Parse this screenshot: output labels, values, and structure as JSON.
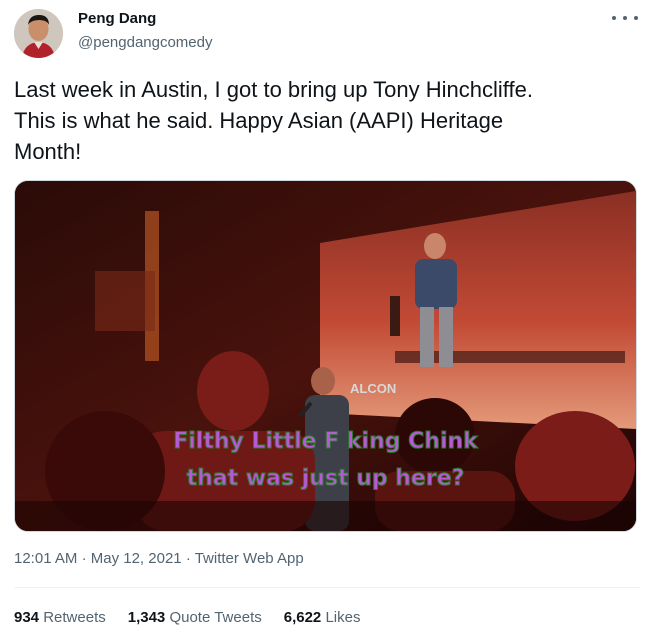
{
  "author": {
    "name": "Peng Dang",
    "handle": "@pengdangcomedy"
  },
  "tweet": {
    "text": "Last week in Austin, I got to bring up Tony Hinchcliffe.\nThis is what he said. Happy Asian (AAPI) Heritage\nMonth!"
  },
  "media": {
    "caption_line1": "Filthy Little F  king Chink",
    "caption_line2": "that was just up here?",
    "screen_logo": "ALCON"
  },
  "meta": {
    "time": "12:01 AM",
    "date": "May 12, 2021",
    "source": "Twitter Web App",
    "sep": "·"
  },
  "stats": {
    "retweets_count": "934",
    "retweets_label": "Retweets",
    "quotes_count": "1,343",
    "quotes_label": "Quote Tweets",
    "likes_count": "6,622",
    "likes_label": "Likes"
  }
}
